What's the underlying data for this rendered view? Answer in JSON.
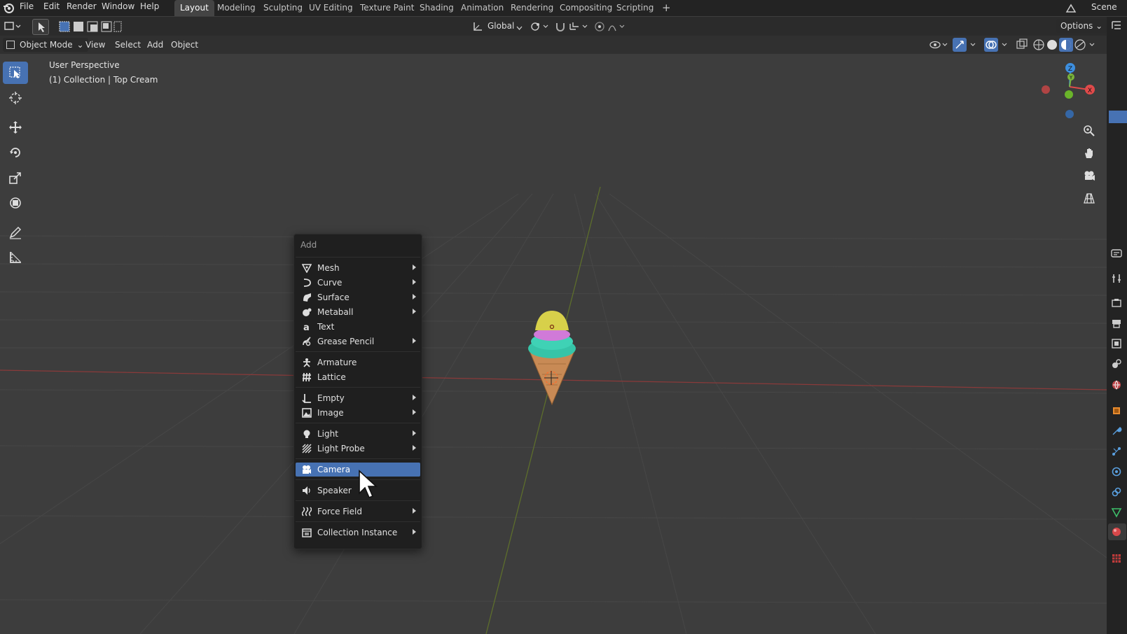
{
  "topbar": {
    "menus": [
      "File",
      "Edit",
      "Render",
      "Window",
      "Help"
    ],
    "workspaces": [
      "Layout",
      "Modeling",
      "Sculpting",
      "UV Editing",
      "Texture Paint",
      "Shading",
      "Animation",
      "Rendering",
      "Compositing",
      "Scripting"
    ],
    "active_workspace": "Layout",
    "add_tab": "+",
    "scene_label": "Scene"
  },
  "header2": {
    "transform_orientation": "Global",
    "options_label": "Options"
  },
  "viewport_header": {
    "mode": "Object Mode",
    "menus": [
      "View",
      "Select",
      "Add",
      "Object"
    ]
  },
  "viewport": {
    "perspective_label": "User Perspective",
    "collection_label": "(1) Collection | Top Cream",
    "gizmo": {
      "z": "Z",
      "y": "Y",
      "x": "X"
    }
  },
  "add_menu": {
    "title": "Add",
    "items": [
      {
        "label": "Mesh",
        "icon": "mesh-icon",
        "submenu": true
      },
      {
        "label": "Curve",
        "icon": "curve-icon",
        "submenu": true
      },
      {
        "label": "Surface",
        "icon": "surface-icon",
        "submenu": true
      },
      {
        "label": "Metaball",
        "icon": "metaball-icon",
        "submenu": true
      },
      {
        "label": "Text",
        "icon": "text-icon",
        "submenu": false
      },
      {
        "label": "Grease Pencil",
        "icon": "grease-pencil-icon",
        "submenu": true
      },
      {
        "label": "Armature",
        "icon": "armature-icon",
        "submenu": false
      },
      {
        "label": "Lattice",
        "icon": "lattice-icon",
        "submenu": false
      },
      {
        "label": "Empty",
        "icon": "empty-icon",
        "submenu": true
      },
      {
        "label": "Image",
        "icon": "image-icon",
        "submenu": true
      },
      {
        "label": "Light",
        "icon": "light-icon",
        "submenu": true
      },
      {
        "label": "Light Probe",
        "icon": "light-probe-icon",
        "submenu": true
      },
      {
        "label": "Camera",
        "icon": "camera-icon",
        "submenu": false,
        "selected": true
      },
      {
        "label": "Speaker",
        "icon": "speaker-icon",
        "submenu": false
      },
      {
        "label": "Force Field",
        "icon": "force-field-icon",
        "submenu": true
      },
      {
        "label": "Collection Instance",
        "icon": "collection-instance-icon",
        "submenu": true
      }
    ]
  },
  "colors": {
    "accent": "#4772b3",
    "axis_x": "#e04a4a",
    "axis_y": "#7ab33a",
    "axis_z": "#3d8fe0"
  }
}
